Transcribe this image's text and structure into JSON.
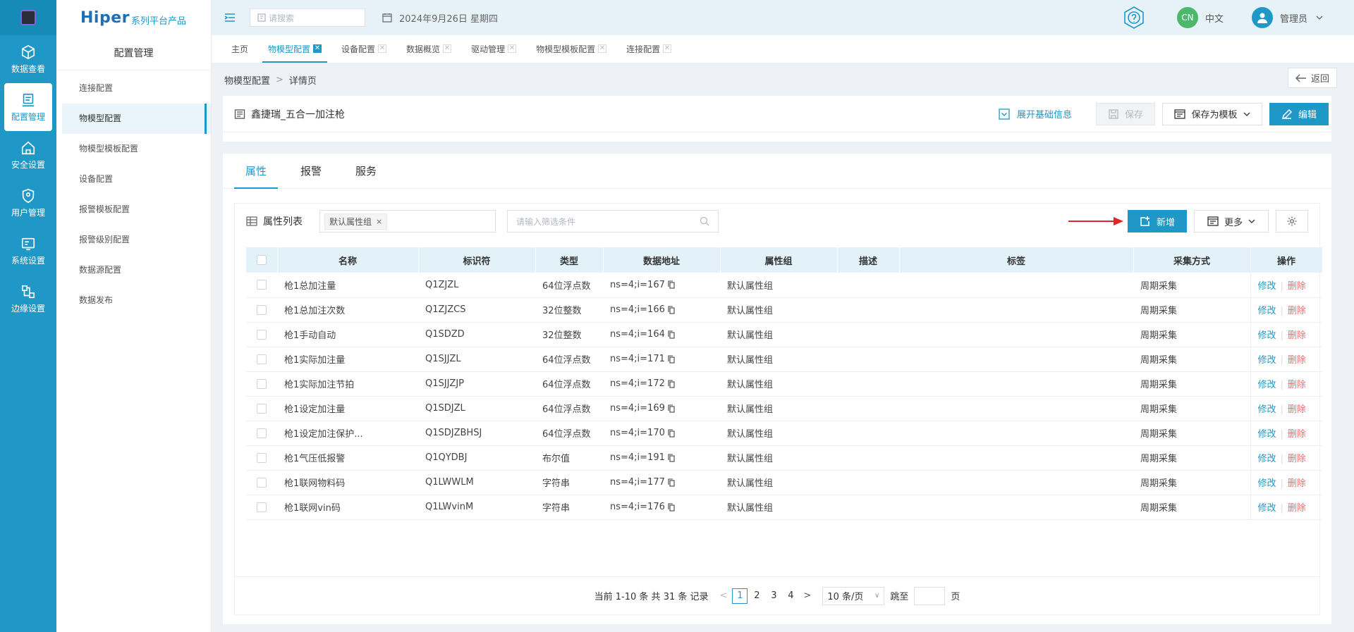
{
  "rail": {
    "items": [
      {
        "label": "数据查看",
        "icon": "cube-icon"
      },
      {
        "label": "配置管理",
        "icon": "config-icon"
      },
      {
        "label": "安全设置",
        "icon": "security-house-icon"
      },
      {
        "label": "用户管理",
        "icon": "shield-user-icon"
      },
      {
        "label": "系统设置",
        "icon": "system-settings-icon"
      },
      {
        "label": "边缘设置",
        "icon": "edge-network-icon"
      }
    ]
  },
  "brand": {
    "main": "Hiper",
    "sub": "系列平台产品"
  },
  "sidebar": {
    "title": "配置管理",
    "items": [
      {
        "label": "连接配置"
      },
      {
        "label": "物模型配置"
      },
      {
        "label": "物模型模板配置"
      },
      {
        "label": "设备配置"
      },
      {
        "label": "报警模板配置"
      },
      {
        "label": "报警级别配置"
      },
      {
        "label": "数据源配置"
      },
      {
        "label": "数据发布"
      }
    ]
  },
  "header": {
    "search_placeholder": "请搜索",
    "date": "2024年9月26日 星期四",
    "lang_avatar": "CN",
    "lang": "中文",
    "user": "管理员"
  },
  "tabs": [
    {
      "label": "主页"
    },
    {
      "label": "物模型配置"
    },
    {
      "label": "设备配置"
    },
    {
      "label": "数据概览"
    },
    {
      "label": "驱动管理"
    },
    {
      "label": "物模型模板配置"
    },
    {
      "label": "连接配置"
    }
  ],
  "breadcrumb": {
    "parent": "物模型配置",
    "sep": ">",
    "current": "详情页"
  },
  "back_label": "返回",
  "device": {
    "title": "鑫捷瑞_五合一加注枪",
    "expand_label": "展开基础信息",
    "save_label": "保存",
    "save_template_label": "保存为模板",
    "edit_label": "编辑"
  },
  "subtabs": [
    {
      "label": "属性"
    },
    {
      "label": "报警"
    },
    {
      "label": "服务"
    }
  ],
  "toolbar": {
    "title": "属性列表",
    "tag": "默认属性组",
    "tag_close": "×",
    "filter_placeholder": "请输入筛选条件",
    "add_label": "新增",
    "more_label": "更多"
  },
  "table": {
    "headers": [
      "名称",
      "标识符",
      "类型",
      "数据地址",
      "属性组",
      "描述",
      "标签",
      "采集方式",
      "操作"
    ],
    "rows": [
      {
        "name": "枪1总加注量",
        "id": "Q1ZJZL",
        "type": "64位浮点数",
        "addr": "ns=4;i=167",
        "group": "默认属性组",
        "desc": "",
        "tag": "",
        "mode": "周期采集"
      },
      {
        "name": "枪1总加注次数",
        "id": "Q1ZJZCS",
        "type": "32位整数",
        "addr": "ns=4;i=166",
        "group": "默认属性组",
        "desc": "",
        "tag": "",
        "mode": "周期采集"
      },
      {
        "name": "枪1手动自动",
        "id": "Q1SDZD",
        "type": "32位整数",
        "addr": "ns=4;i=164",
        "group": "默认属性组",
        "desc": "",
        "tag": "",
        "mode": "周期采集"
      },
      {
        "name": "枪1实际加注量",
        "id": "Q1SJJZL",
        "type": "64位浮点数",
        "addr": "ns=4;i=171",
        "group": "默认属性组",
        "desc": "",
        "tag": "",
        "mode": "周期采集"
      },
      {
        "name": "枪1实际加注节拍",
        "id": "Q1SJJZJP",
        "type": "64位浮点数",
        "addr": "ns=4;i=172",
        "group": "默认属性组",
        "desc": "",
        "tag": "",
        "mode": "周期采集"
      },
      {
        "name": "枪1设定加注量",
        "id": "Q1SDJZL",
        "type": "64位浮点数",
        "addr": "ns=4;i=169",
        "group": "默认属性组",
        "desc": "",
        "tag": "",
        "mode": "周期采集"
      },
      {
        "name": "枪1设定加注保护...",
        "id": "Q1SDJZBHSJ",
        "type": "64位浮点数",
        "addr": "ns=4;i=170",
        "group": "默认属性组",
        "desc": "",
        "tag": "",
        "mode": "周期采集"
      },
      {
        "name": "枪1气压低报警",
        "id": "Q1QYDBJ",
        "type": "布尔值",
        "addr": "ns=4;i=191",
        "group": "默认属性组",
        "desc": "",
        "tag": "",
        "mode": "周期采集"
      },
      {
        "name": "枪1联网物料码",
        "id": "Q1LWWLM",
        "type": "字符串",
        "addr": "ns=4;i=177",
        "group": "默认属性组",
        "desc": "",
        "tag": "",
        "mode": "周期采集"
      },
      {
        "name": "枪1联网vin码",
        "id": "Q1LWvinM",
        "type": "字符串",
        "addr": "ns=4;i=176",
        "group": "默认属性组",
        "desc": "",
        "tag": "",
        "mode": "周期采集"
      }
    ],
    "edit_label": "修改",
    "delete_label": "删除",
    "op_sep": "|"
  },
  "pagination": {
    "summary": "当前 1-10 条 共 31 条 记录",
    "prev": "<",
    "next": ">",
    "pages": [
      "1",
      "2",
      "3",
      "4"
    ],
    "current_page": "1",
    "page_size": "10 条/页",
    "jump_label": "跳至",
    "page_unit": "页"
  },
  "colors": {
    "accent": "#1f98c7",
    "danger": "#f56c6c",
    "arrow": "#e0262b"
  }
}
